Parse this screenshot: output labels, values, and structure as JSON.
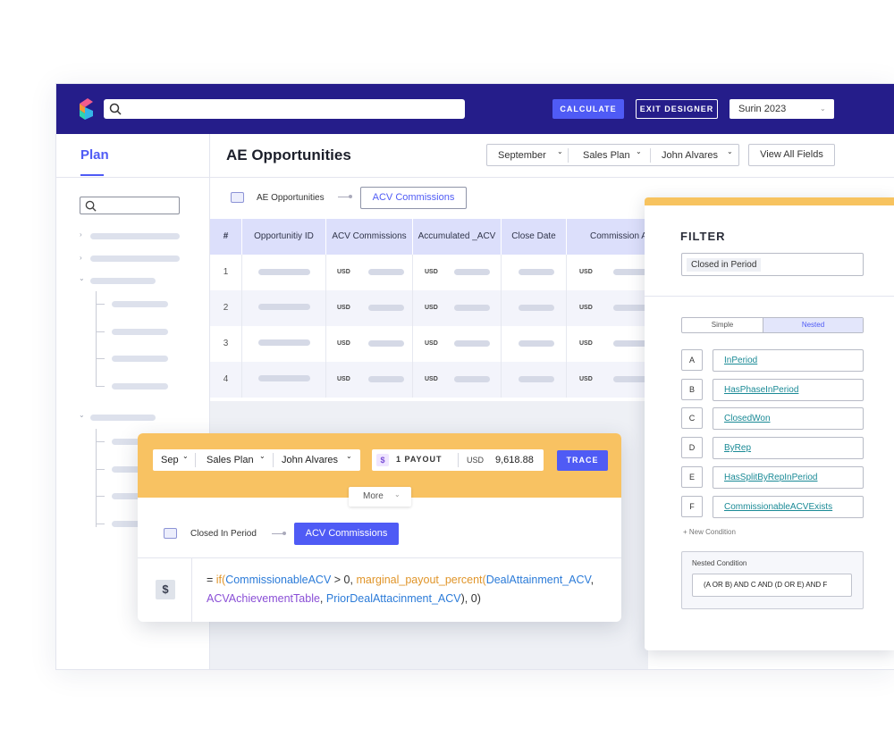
{
  "topbar": {
    "calculate_label": "CALCULATE",
    "exit_label": "EXIT DESIGNER",
    "year_select": "Surin 2023"
  },
  "sidebar": {
    "tab_label": "Plan"
  },
  "main": {
    "title": "AE Opportunities",
    "filters": {
      "month": "September",
      "plan": "Sales Plan",
      "person": "John Alvares"
    },
    "view_all_label": "View All Fields",
    "breadcrumb": {
      "source": "AE Opportunities",
      "target": "ACV Commissions"
    },
    "table": {
      "columns": [
        "#",
        "Opportunitiy ID",
        "ACV Commissions",
        "Accumulated _ACV",
        "Close Date",
        "Commission ACV"
      ],
      "rows": [
        {
          "num": "1",
          "currency1": "USD",
          "currency2": "USD",
          "currency3": "USD"
        },
        {
          "num": "2",
          "currency1": "USD",
          "currency2": "USD",
          "currency3": "USD"
        },
        {
          "num": "3",
          "currency1": "USD",
          "currency2": "USD",
          "currency3": "USD"
        },
        {
          "num": "4",
          "currency1": "USD",
          "currency2": "USD",
          "currency3": "USD"
        }
      ]
    }
  },
  "filter_panel": {
    "title": "FILTER",
    "selected_chip": "Closed in Period",
    "toggle": {
      "simple": "Simple",
      "nested": "Nested",
      "active": "Nested"
    },
    "conditions": [
      {
        "letter": "A",
        "name": "InPeriod"
      },
      {
        "letter": "B",
        "name": "HasPhaseInPeriod"
      },
      {
        "letter": "C",
        "name": "ClosedWon"
      },
      {
        "letter": "D",
        "name": "ByRep"
      },
      {
        "letter": "E",
        "name": "HasSplitByRepInPeriod"
      },
      {
        "letter": "F",
        "name": "CommissionableACVExists"
      }
    ],
    "new_condition_label": "+ New Condition",
    "nested_condition_label": "Nested Condition",
    "nested_expression": "(A OR B) AND C AND (D OR E) AND F"
  },
  "trace_card": {
    "month": "Sep",
    "plan": "Sales Plan",
    "person": "John Alvares",
    "payout_icon": "$",
    "payout_label": "1 PAYOUT",
    "currency": "USD",
    "amount": "9,618.88",
    "trace_label": "TRACE",
    "more_label": "More",
    "breadcrumb": {
      "source": "Closed In Period",
      "target": "ACV Commissions"
    },
    "formula_icon": "$",
    "formula": {
      "p1": "= ",
      "p2": "if(",
      "p3": "CommissionableACV",
      "p4": " > 0, ",
      "p5": "marginal_payout_percent(",
      "p6": "DealAttainment_ACV",
      "p7": ", ",
      "p8": "ACVAchievementTable",
      "p9": ", ",
      "p10": "PriorDealAttacinment_ACV",
      "p11": "), 0)"
    }
  },
  "colors": {
    "topbar": "#251d8a",
    "accent": "#4f5bf5",
    "card_header": "#f8c262",
    "table_header": "#dcdffb",
    "condition_link": "#1a8a96"
  }
}
